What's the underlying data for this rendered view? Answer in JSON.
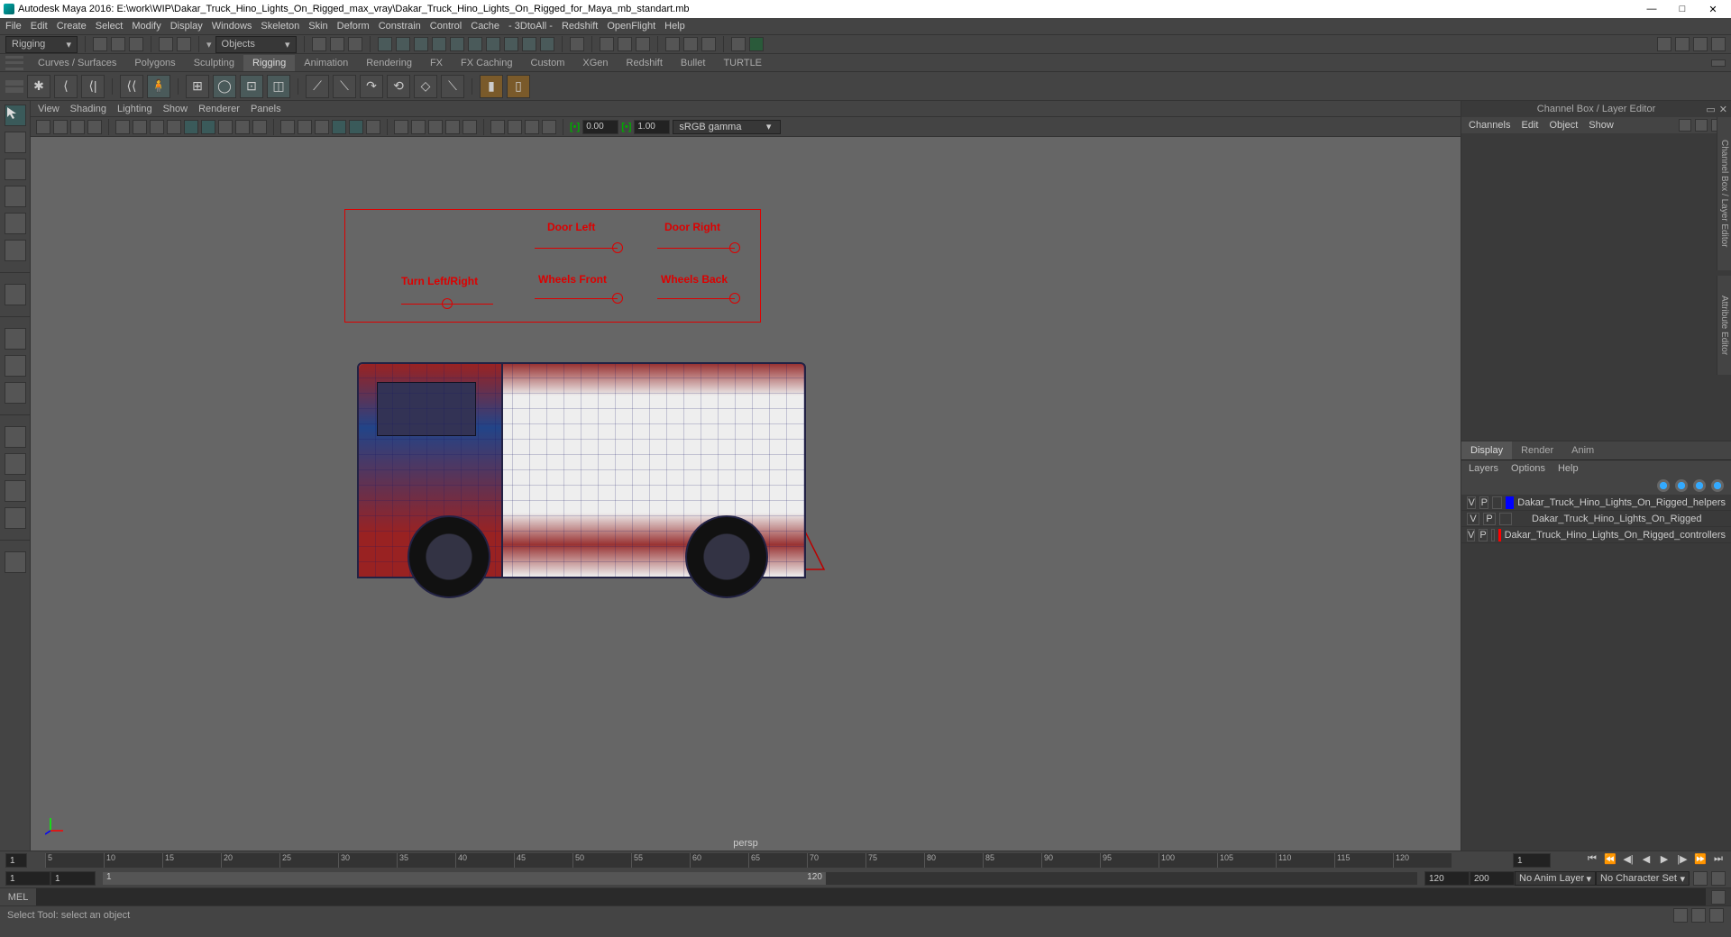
{
  "window": {
    "title": "Autodesk Maya 2016: E:\\work\\WIP\\Dakar_Truck_Hino_Lights_On_Rigged_max_vray\\Dakar_Truck_Hino_Lights_On_Rigged_for_Maya_mb_standart.mb",
    "controls": {
      "min": "—",
      "max": "□",
      "close": "✕"
    }
  },
  "menubar": [
    "File",
    "Edit",
    "Create",
    "Select",
    "Modify",
    "Display",
    "Windows",
    "Skeleton",
    "Skin",
    "Deform",
    "Constrain",
    "Control",
    "Cache",
    "- 3DtoAll -",
    "Redshift",
    "OpenFlight",
    "Help"
  ],
  "workspace": {
    "selected": "Rigging"
  },
  "selectMenu": "Objects",
  "shelfTabs": [
    "Curves / Surfaces",
    "Polygons",
    "Sculpting",
    "Rigging",
    "Animation",
    "Rendering",
    "FX",
    "FX Caching",
    "Custom",
    "XGen",
    "Redshift",
    "Bullet",
    "TURTLE"
  ],
  "activeShelfTab": "Rigging",
  "viewport": {
    "panelMenu": [
      "View",
      "Shading",
      "Lighting",
      "Show",
      "Renderer",
      "Panels"
    ],
    "exp1": "0.00",
    "exp2": "1.00",
    "colorspace": "sRGB gamma",
    "camera": "persp",
    "rig": {
      "labels": {
        "turn": "Turn  Left/Right",
        "doorLeft": "Door Left",
        "doorRight": "Door Right",
        "wheelsFront": "Wheels Front",
        "wheelsBack": "Wheels Back"
      }
    }
  },
  "timeline": {
    "cursor": "1",
    "ticks": [
      "5",
      "10",
      "15",
      "20",
      "25",
      "30",
      "35",
      "40",
      "45",
      "50",
      "55",
      "60",
      "65",
      "70",
      "75",
      "80",
      "85",
      "90",
      "95",
      "100",
      "105",
      "110",
      "115",
      "120"
    ],
    "endDisplay": "1",
    "rangeStart": "1",
    "rangeInnerStart": "1",
    "rangeInnerEnd": "120",
    "rangeEnd": "120",
    "endFrame": "200",
    "animLayer": "No Anim Layer",
    "charSet": "No Character Set"
  },
  "command": {
    "label": "MEL",
    "value": ""
  },
  "status": {
    "help": "Select Tool: select an object"
  },
  "channelBox": {
    "title": "Channel Box / Layer Editor",
    "menu": [
      "Channels",
      "Edit",
      "Object",
      "Show"
    ],
    "layerTabs": [
      "Display",
      "Render",
      "Anim"
    ],
    "activeLayerTab": "Display",
    "layerMenu": [
      "Layers",
      "Options",
      "Help"
    ],
    "layers": [
      {
        "v": "V",
        "p": "P",
        "color": "#0000ff",
        "name": "Dakar_Truck_Hino_Lights_On_Rigged_helpers"
      },
      {
        "v": "V",
        "p": "P",
        "color": "",
        "name": "Dakar_Truck_Hino_Lights_On_Rigged"
      },
      {
        "v": "V",
        "p": "P",
        "color": "#ff0000",
        "name": "Dakar_Truck_Hino_Lights_On_Rigged_controllers"
      }
    ]
  },
  "edgeTabs": {
    "top": "Channel Box / Layer Editor",
    "bottom": "Attribute Editor"
  }
}
